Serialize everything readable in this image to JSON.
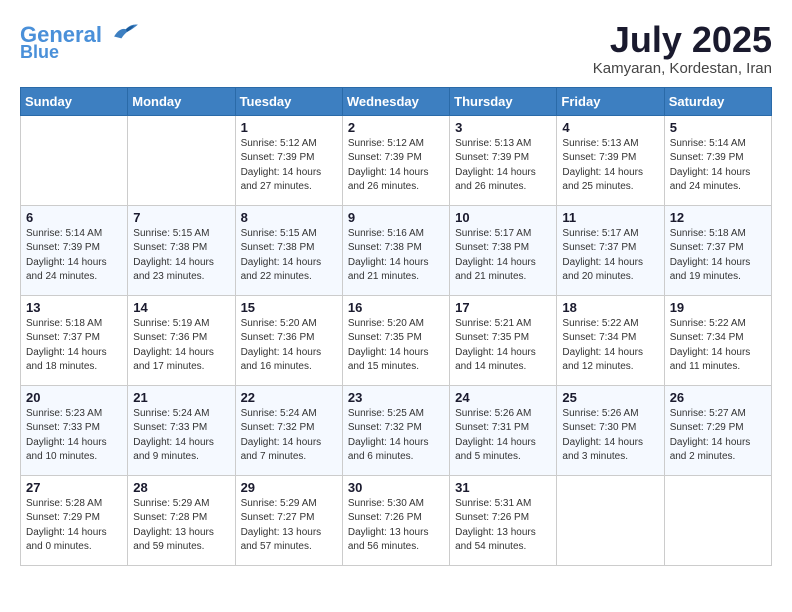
{
  "header": {
    "logo_line1": "General",
    "logo_line2": "Blue",
    "month_title": "July 2025",
    "subtitle": "Kamyaran, Kordestan, Iran"
  },
  "days_of_week": [
    "Sunday",
    "Monday",
    "Tuesday",
    "Wednesday",
    "Thursday",
    "Friday",
    "Saturday"
  ],
  "weeks": [
    [
      {
        "day": "",
        "info": ""
      },
      {
        "day": "",
        "info": ""
      },
      {
        "day": "1",
        "info": "Sunrise: 5:12 AM\nSunset: 7:39 PM\nDaylight: 14 hours and 27 minutes."
      },
      {
        "day": "2",
        "info": "Sunrise: 5:12 AM\nSunset: 7:39 PM\nDaylight: 14 hours and 26 minutes."
      },
      {
        "day": "3",
        "info": "Sunrise: 5:13 AM\nSunset: 7:39 PM\nDaylight: 14 hours and 26 minutes."
      },
      {
        "day": "4",
        "info": "Sunrise: 5:13 AM\nSunset: 7:39 PM\nDaylight: 14 hours and 25 minutes."
      },
      {
        "day": "5",
        "info": "Sunrise: 5:14 AM\nSunset: 7:39 PM\nDaylight: 14 hours and 24 minutes."
      }
    ],
    [
      {
        "day": "6",
        "info": "Sunrise: 5:14 AM\nSunset: 7:39 PM\nDaylight: 14 hours and 24 minutes."
      },
      {
        "day": "7",
        "info": "Sunrise: 5:15 AM\nSunset: 7:38 PM\nDaylight: 14 hours and 23 minutes."
      },
      {
        "day": "8",
        "info": "Sunrise: 5:15 AM\nSunset: 7:38 PM\nDaylight: 14 hours and 22 minutes."
      },
      {
        "day": "9",
        "info": "Sunrise: 5:16 AM\nSunset: 7:38 PM\nDaylight: 14 hours and 21 minutes."
      },
      {
        "day": "10",
        "info": "Sunrise: 5:17 AM\nSunset: 7:38 PM\nDaylight: 14 hours and 21 minutes."
      },
      {
        "day": "11",
        "info": "Sunrise: 5:17 AM\nSunset: 7:37 PM\nDaylight: 14 hours and 20 minutes."
      },
      {
        "day": "12",
        "info": "Sunrise: 5:18 AM\nSunset: 7:37 PM\nDaylight: 14 hours and 19 minutes."
      }
    ],
    [
      {
        "day": "13",
        "info": "Sunrise: 5:18 AM\nSunset: 7:37 PM\nDaylight: 14 hours and 18 minutes."
      },
      {
        "day": "14",
        "info": "Sunrise: 5:19 AM\nSunset: 7:36 PM\nDaylight: 14 hours and 17 minutes."
      },
      {
        "day": "15",
        "info": "Sunrise: 5:20 AM\nSunset: 7:36 PM\nDaylight: 14 hours and 16 minutes."
      },
      {
        "day": "16",
        "info": "Sunrise: 5:20 AM\nSunset: 7:35 PM\nDaylight: 14 hours and 15 minutes."
      },
      {
        "day": "17",
        "info": "Sunrise: 5:21 AM\nSunset: 7:35 PM\nDaylight: 14 hours and 14 minutes."
      },
      {
        "day": "18",
        "info": "Sunrise: 5:22 AM\nSunset: 7:34 PM\nDaylight: 14 hours and 12 minutes."
      },
      {
        "day": "19",
        "info": "Sunrise: 5:22 AM\nSunset: 7:34 PM\nDaylight: 14 hours and 11 minutes."
      }
    ],
    [
      {
        "day": "20",
        "info": "Sunrise: 5:23 AM\nSunset: 7:33 PM\nDaylight: 14 hours and 10 minutes."
      },
      {
        "day": "21",
        "info": "Sunrise: 5:24 AM\nSunset: 7:33 PM\nDaylight: 14 hours and 9 minutes."
      },
      {
        "day": "22",
        "info": "Sunrise: 5:24 AM\nSunset: 7:32 PM\nDaylight: 14 hours and 7 minutes."
      },
      {
        "day": "23",
        "info": "Sunrise: 5:25 AM\nSunset: 7:32 PM\nDaylight: 14 hours and 6 minutes."
      },
      {
        "day": "24",
        "info": "Sunrise: 5:26 AM\nSunset: 7:31 PM\nDaylight: 14 hours and 5 minutes."
      },
      {
        "day": "25",
        "info": "Sunrise: 5:26 AM\nSunset: 7:30 PM\nDaylight: 14 hours and 3 minutes."
      },
      {
        "day": "26",
        "info": "Sunrise: 5:27 AM\nSunset: 7:29 PM\nDaylight: 14 hours and 2 minutes."
      }
    ],
    [
      {
        "day": "27",
        "info": "Sunrise: 5:28 AM\nSunset: 7:29 PM\nDaylight: 14 hours and 0 minutes."
      },
      {
        "day": "28",
        "info": "Sunrise: 5:29 AM\nSunset: 7:28 PM\nDaylight: 13 hours and 59 minutes."
      },
      {
        "day": "29",
        "info": "Sunrise: 5:29 AM\nSunset: 7:27 PM\nDaylight: 13 hours and 57 minutes."
      },
      {
        "day": "30",
        "info": "Sunrise: 5:30 AM\nSunset: 7:26 PM\nDaylight: 13 hours and 56 minutes."
      },
      {
        "day": "31",
        "info": "Sunrise: 5:31 AM\nSunset: 7:26 PM\nDaylight: 13 hours and 54 minutes."
      },
      {
        "day": "",
        "info": ""
      },
      {
        "day": "",
        "info": ""
      }
    ]
  ]
}
